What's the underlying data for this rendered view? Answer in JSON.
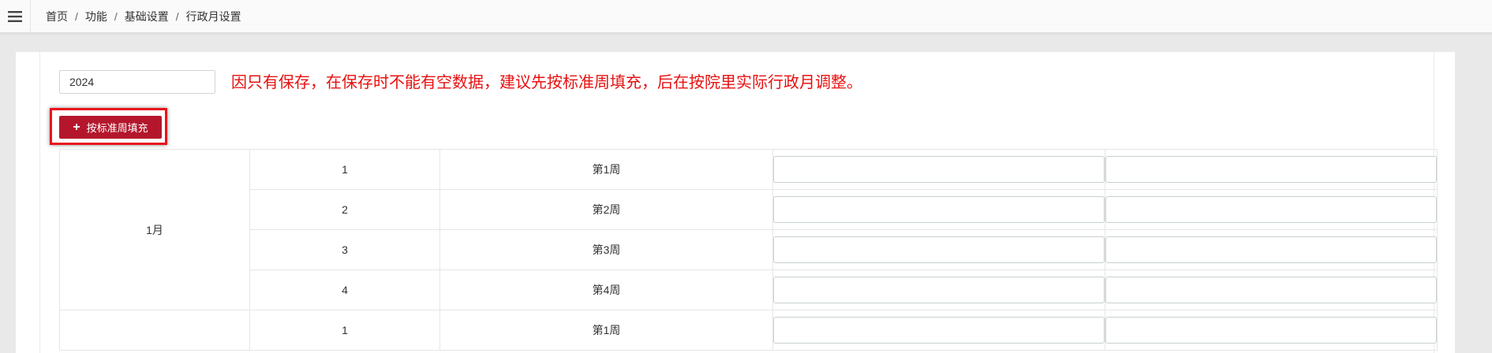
{
  "breadcrumb": {
    "items": [
      "首页",
      "功能",
      "基础设置",
      "行政月设置"
    ],
    "separator": "/"
  },
  "year_input": {
    "value": "2024"
  },
  "notice": "因只有保存，在保存时不能有空数据，建议先按标准周填充，后在按院里实际行政月调整。",
  "fill_button": {
    "label": "按标准周填充"
  },
  "month_groups": [
    {
      "month": "1月",
      "rows": [
        {
          "index": "1",
          "week": "第1周",
          "start": "",
          "end": ""
        },
        {
          "index": "2",
          "week": "第2周",
          "start": "",
          "end": ""
        },
        {
          "index": "3",
          "week": "第3周",
          "start": "",
          "end": ""
        },
        {
          "index": "4",
          "week": "第4周",
          "start": "",
          "end": ""
        }
      ]
    },
    {
      "month": "",
      "rows": [
        {
          "index": "1",
          "week": "第1周",
          "start": "",
          "end": ""
        }
      ]
    }
  ],
  "colors": {
    "button_bg": "#b4172c",
    "highlight_border": "#e8141d",
    "notice_text": "#e81010"
  },
  "icons": {
    "menu": "hamburger-menu-icon",
    "add": "plus-icon"
  }
}
